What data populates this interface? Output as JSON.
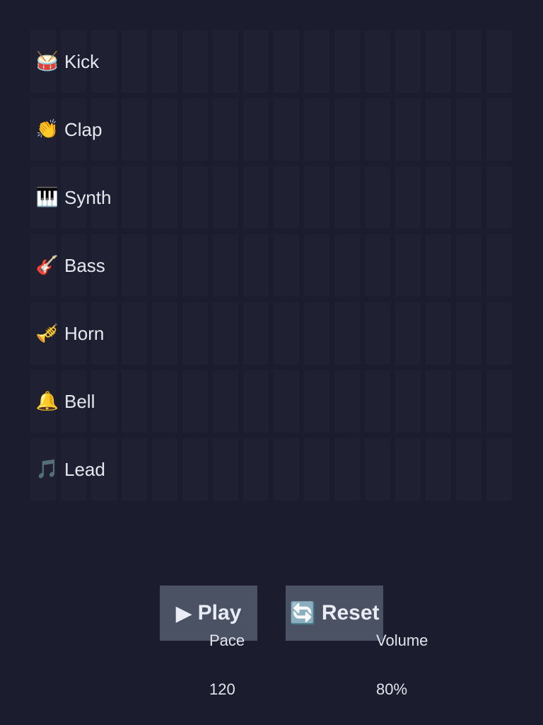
{
  "tracks": [
    {
      "icon": "🥁",
      "icon_name": "drum-icon",
      "label": "Kick"
    },
    {
      "icon": "👏",
      "icon_name": "clap-icon",
      "label": "Clap"
    },
    {
      "icon": "🎹",
      "icon_name": "piano-icon",
      "label": "Synth"
    },
    {
      "icon": "🎸",
      "icon_name": "guitar-icon",
      "label": "Bass"
    },
    {
      "icon": "🎺",
      "icon_name": "trumpet-icon",
      "label": "Horn"
    },
    {
      "icon": "🔔",
      "icon_name": "bell-icon",
      "label": "Bell"
    },
    {
      "icon": "🎵",
      "icon_name": "music-note-icon",
      "label": "Lead"
    }
  ],
  "steps_per_track": 16,
  "controls": {
    "play_icon": "▶",
    "play_label": "Play",
    "reset_icon": "🔄",
    "reset_label": "Reset",
    "pace_label": "Pace",
    "pace_value": "120",
    "volume_label": "Volume",
    "volume_value": "80%"
  },
  "colors": {
    "background": "#1b1c2e",
    "cell": "#1f2133",
    "button": "#4a5263",
    "text": "#e6e8f0"
  }
}
